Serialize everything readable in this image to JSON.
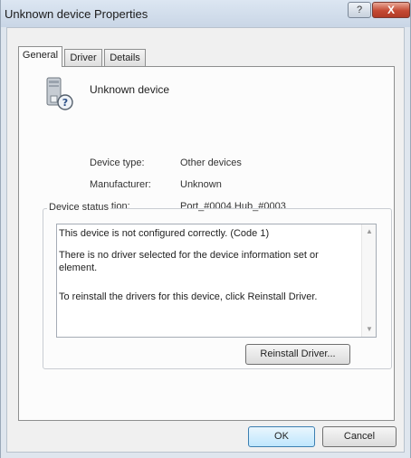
{
  "window": {
    "title": "Unknown device Properties",
    "help_label": "?",
    "close_label": "X"
  },
  "tabs": [
    {
      "label": "General",
      "active": true
    },
    {
      "label": "Driver",
      "active": false
    },
    {
      "label": "Details",
      "active": false
    }
  ],
  "device": {
    "icon": "unknown-device-icon",
    "name": "Unknown device"
  },
  "properties": [
    {
      "label": "Device type:",
      "value": "Other devices"
    },
    {
      "label": "Manufacturer:",
      "value": "Unknown"
    },
    {
      "label": "Location:",
      "value": "Port_#0004.Hub_#0003"
    }
  ],
  "status": {
    "legend": "Device status",
    "lines": [
      "This device is not configured correctly. (Code 1)",
      "There is no driver selected for the device information set or element.",
      "To reinstall the drivers for this device, click Reinstall Driver."
    ]
  },
  "buttons": {
    "reinstall": "Reinstall Driver...",
    "ok": "OK",
    "cancel": "Cancel"
  }
}
